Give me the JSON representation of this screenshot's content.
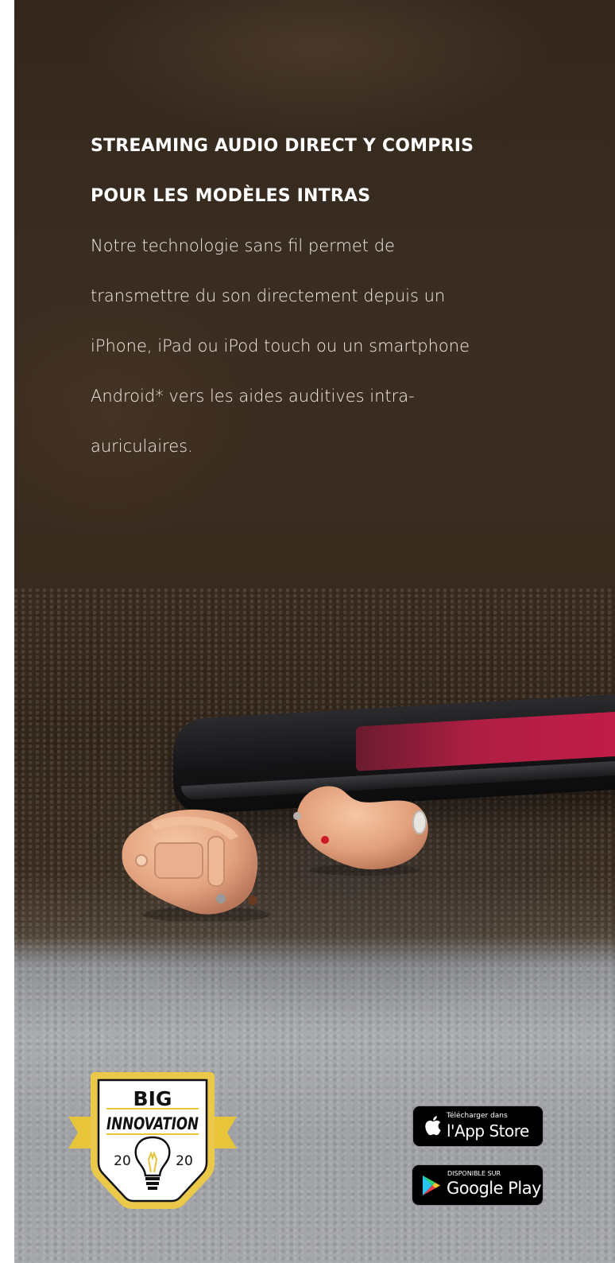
{
  "hero": {
    "heading_lines": [
      "STREAMING AUDIO DIRECT Y COMPRIS",
      "POUR LES MODÈLES INTRAS"
    ],
    "body_lines": [
      "Notre technologie sans fil  permet de",
      "transmettre du son directement depuis un",
      "iPhone, iPad ou iPod touch  ou un smartphone",
      "Android* vers les aides auditives intra-",
      "auriculaires."
    ]
  },
  "award": {
    "line1": "BIG",
    "line2": "INNOVATION",
    "year_left": "20",
    "year_right": "20",
    "icon": "lightbulb-icon",
    "colors": {
      "ribbon": "#e8c43a",
      "frame": "#e9c84a",
      "text": "#111111"
    }
  },
  "stores": {
    "appstore": {
      "small": "Télécharger dans",
      "big": "l'App Store",
      "icon": "apple-icon"
    },
    "googleplay": {
      "small": "DISPONIBLE SUR",
      "big": "Google Play",
      "icon": "google-play-icon"
    }
  },
  "colors": {
    "dark_bg": "#3a2b1f",
    "felt": "#a6a8ac",
    "phone_screen": "#b01e44",
    "aid_skin": "#e8b08e"
  }
}
